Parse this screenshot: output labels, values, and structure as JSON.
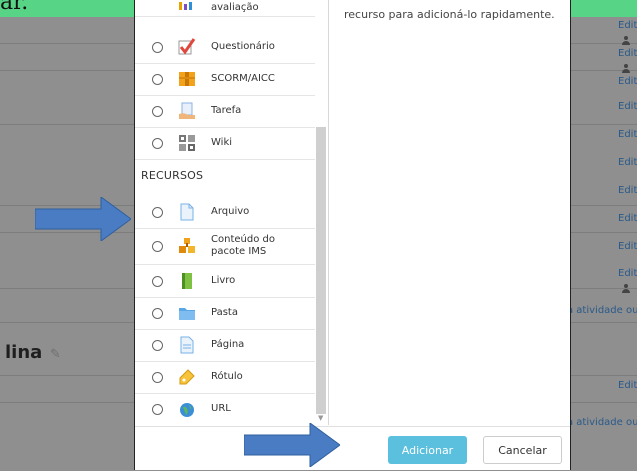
{
  "top_banner": {
    "text": "ar."
  },
  "background": {
    "edit_label": "Edit",
    "add_activity_label": "a atividade ou",
    "section_title": "lina"
  },
  "chooser": {
    "description": "recurso para adicioná-lo rapidamente.",
    "partial_top_label": "avaliação",
    "activities": [
      {
        "label": "Questionário",
        "icon": "quiz-check-icon"
      },
      {
        "label": "SCORM/AICC",
        "icon": "scorm-package-icon"
      },
      {
        "label": "Tarefa",
        "icon": "assignment-hand-icon"
      },
      {
        "label": "Wiki",
        "icon": "wiki-icon"
      }
    ],
    "resources_heading": "RECURSOS",
    "resources": [
      {
        "label": "Arquivo",
        "icon": "file-icon"
      },
      {
        "label": "Conteúdo do pacote IMS",
        "icon": "ims-package-icon"
      },
      {
        "label": "Livro",
        "icon": "book-icon"
      },
      {
        "label": "Pasta",
        "icon": "folder-icon"
      },
      {
        "label": "Página",
        "icon": "page-icon"
      },
      {
        "label": "Rótulo",
        "icon": "label-tag-icon"
      },
      {
        "label": "URL",
        "icon": "url-globe-icon"
      }
    ],
    "add_button": "Adicionar",
    "cancel_button": "Cancelar"
  },
  "colors": {
    "primary_button": "#5bc0de",
    "overlay": "#8f8f8f",
    "banner": "#57d485",
    "arrow": "#4a7cc4"
  }
}
